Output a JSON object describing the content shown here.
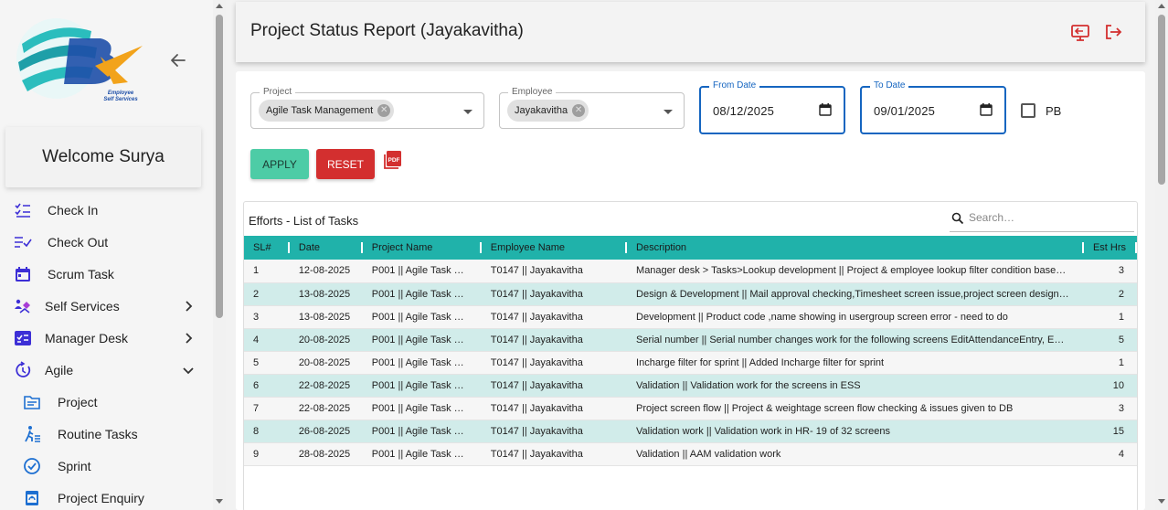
{
  "app": {
    "logo_text_line1": "Employee",
    "logo_text_line2": "Self Services",
    "welcome": "Welcome Surya",
    "colors": {
      "accent": "#20b2aa",
      "danger": "#d32f2f",
      "apply": "#4dcca6",
      "focus": "#1565c0",
      "nav_icon": "#3d2fd6"
    }
  },
  "sidebar": {
    "items": [
      {
        "label": "Check In",
        "icon": "checklist-icon"
      },
      {
        "label": "Check Out",
        "icon": "checkout-list-icon"
      },
      {
        "label": "Scrum Task",
        "icon": "calendar-icon"
      },
      {
        "label": "Self Services",
        "icon": "services-icon",
        "expand": "chevron-right-icon"
      },
      {
        "label": "Manager Desk",
        "icon": "approval-icon",
        "expand": "chevron-right-icon"
      },
      {
        "label": "Agile",
        "icon": "agile-cycle-icon",
        "expand": "chevron-down-icon"
      },
      {
        "label": "Project",
        "icon": "folder-icon"
      },
      {
        "label": "Routine Tasks",
        "icon": "walking-person-icon"
      },
      {
        "label": "Sprint",
        "icon": "check-circle-icon"
      },
      {
        "label": "Project Enquiry",
        "icon": "enquiry-icon"
      }
    ]
  },
  "header": {
    "title": "Project Status Report (Jayakavitha)"
  },
  "filters": {
    "project": {
      "label": "Project",
      "chip": "Agile Task Management"
    },
    "employee": {
      "label": "Employee",
      "chip": "Jayakavitha"
    },
    "from_date": {
      "label": "From Date",
      "value": "08/12/2025"
    },
    "to_date": {
      "label": "To Date",
      "value": "09/01/2025"
    },
    "pb_label": "PB",
    "pb_checked": false
  },
  "actions": {
    "apply_label": "APPLY",
    "reset_label": "RESET",
    "pdf_icon": "pdf-icon"
  },
  "table": {
    "title": "Efforts - List of Tasks",
    "search_placeholder": "Search…",
    "columns": [
      "SL#",
      "Date",
      "Project Name",
      "Employee Name",
      "Description",
      "Est Hrs"
    ],
    "rows": [
      [
        "1",
        "12-08-2025",
        "P001 || Agile Task M…",
        "T0147 || Jayakavitha",
        "Manager desk > Tasks>Lookup development || Project & employee lookup filter condition base…",
        "3"
      ],
      [
        "2",
        "13-08-2025",
        "P001 || Agile Task M…",
        "T0147 || Jayakavitha",
        "Design & Development || Mail approval checking,Timesheet screen issue,project screen design…",
        "2"
      ],
      [
        "3",
        "13-08-2025",
        "P001 || Agile Task M…",
        "T0147 || Jayakavitha",
        "Development || Product code ,name showing in usergroup screen error - need to do",
        "1"
      ],
      [
        "4",
        "20-08-2025",
        "P001 || Agile Task M…",
        "T0147 || Jayakavitha",
        "Serial number || Serial number changes work for the following screens EditAttendanceEntry, E…",
        "5"
      ],
      [
        "5",
        "20-08-2025",
        "P001 || Agile Task M…",
        "T0147 || Jayakavitha",
        "Incharge filter for sprint || Added Incharge filter for sprint",
        "1"
      ],
      [
        "6",
        "22-08-2025",
        "P001 || Agile Task M…",
        "T0147 || Jayakavitha",
        "Validation || Validation work for the screens in ESS",
        "10"
      ],
      [
        "7",
        "22-08-2025",
        "P001 || Agile Task M…",
        "T0147 || Jayakavitha",
        "Project screen flow || Project & weightage screen flow checking & issues given to DB",
        "3"
      ],
      [
        "8",
        "26-08-2025",
        "P001 || Agile Task M…",
        "T0147 || Jayakavitha",
        "Validation work || Validation work in HR- 19 of 32 screens",
        "15"
      ],
      [
        "9",
        "28-08-2025",
        "P001 || Agile Task M…",
        "T0147 || Jayakavitha",
        "Validation || AAM validation work",
        "4"
      ]
    ]
  }
}
